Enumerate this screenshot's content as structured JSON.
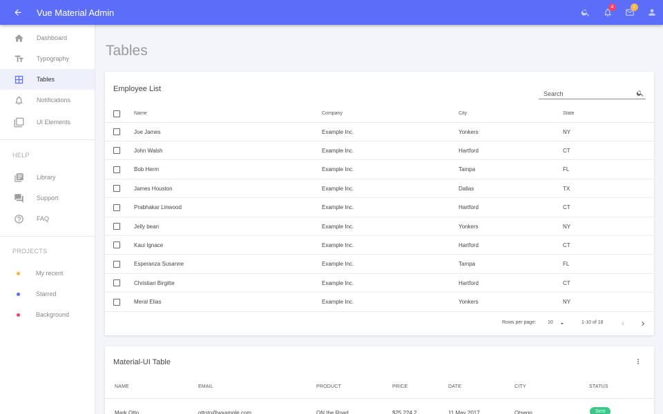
{
  "header": {
    "title": "Vue Material Admin",
    "notification_count": "4",
    "mail_count": "2"
  },
  "sidebar": {
    "items": [
      {
        "label": "Dashboard"
      },
      {
        "label": "Typography"
      },
      {
        "label": "Tables"
      },
      {
        "label": "Notifications"
      },
      {
        "label": "UI Elements"
      }
    ],
    "help_heading": "HELP",
    "help_items": [
      {
        "label": "Library"
      },
      {
        "label": "Support"
      },
      {
        "label": "FAQ"
      }
    ],
    "projects_heading": "PROJECTS",
    "projects": [
      {
        "label": "My recent",
        "color": "#f6b34a"
      },
      {
        "label": "Starred",
        "color": "#5c6ef8"
      },
      {
        "label": "Background",
        "color": "#f44366"
      }
    ]
  },
  "main": {
    "page_title": "Tables",
    "employee_table": {
      "title": "Employee List",
      "search_placeholder": "Search",
      "columns": [
        "Name",
        "Company",
        "City",
        "State"
      ],
      "rows": [
        [
          "Joe James",
          "Example Inc.",
          "Yonkers",
          "NY"
        ],
        [
          "John Walsh",
          "Example Inc.",
          "Hartford",
          "CT"
        ],
        [
          "Bob Herm",
          "Example Inc.",
          "Tampa",
          "FL"
        ],
        [
          "James Houston",
          "Example Inc.",
          "Dallas",
          "TX"
        ],
        [
          "Prabhakar Linwood",
          "Example Inc.",
          "Hartford",
          "CT"
        ],
        [
          "Jelly bean",
          "Example Inc.",
          "Yonkers",
          "NY"
        ],
        [
          "Kaui Ignace",
          "Example Inc.",
          "Hartford",
          "CT"
        ],
        [
          "Esperanza Susanne",
          "Example Inc.",
          "Tampa",
          "FL"
        ],
        [
          "Christian Birgitte",
          "Example Inc.",
          "Hartford",
          "CT"
        ],
        [
          "Meral Elias",
          "Example Inc.",
          "Yonkers",
          "NY"
        ]
      ],
      "rows_per_page_label": "Rows per page:",
      "rows_per_page_value": "10",
      "range_label": "1-10 of 18"
    },
    "material_table": {
      "title": "Material-UI Table",
      "columns": [
        "NAME",
        "EMAIL",
        "PRODUCT",
        "PRICE",
        "DATE",
        "CITY",
        "STATUS"
      ],
      "rows": [
        [
          "Mark Otto",
          "ottoto@wxample.com",
          "ON the Road",
          "$25 224.2",
          "11 May 2017",
          "Otsego",
          "Sent"
        ]
      ]
    }
  }
}
